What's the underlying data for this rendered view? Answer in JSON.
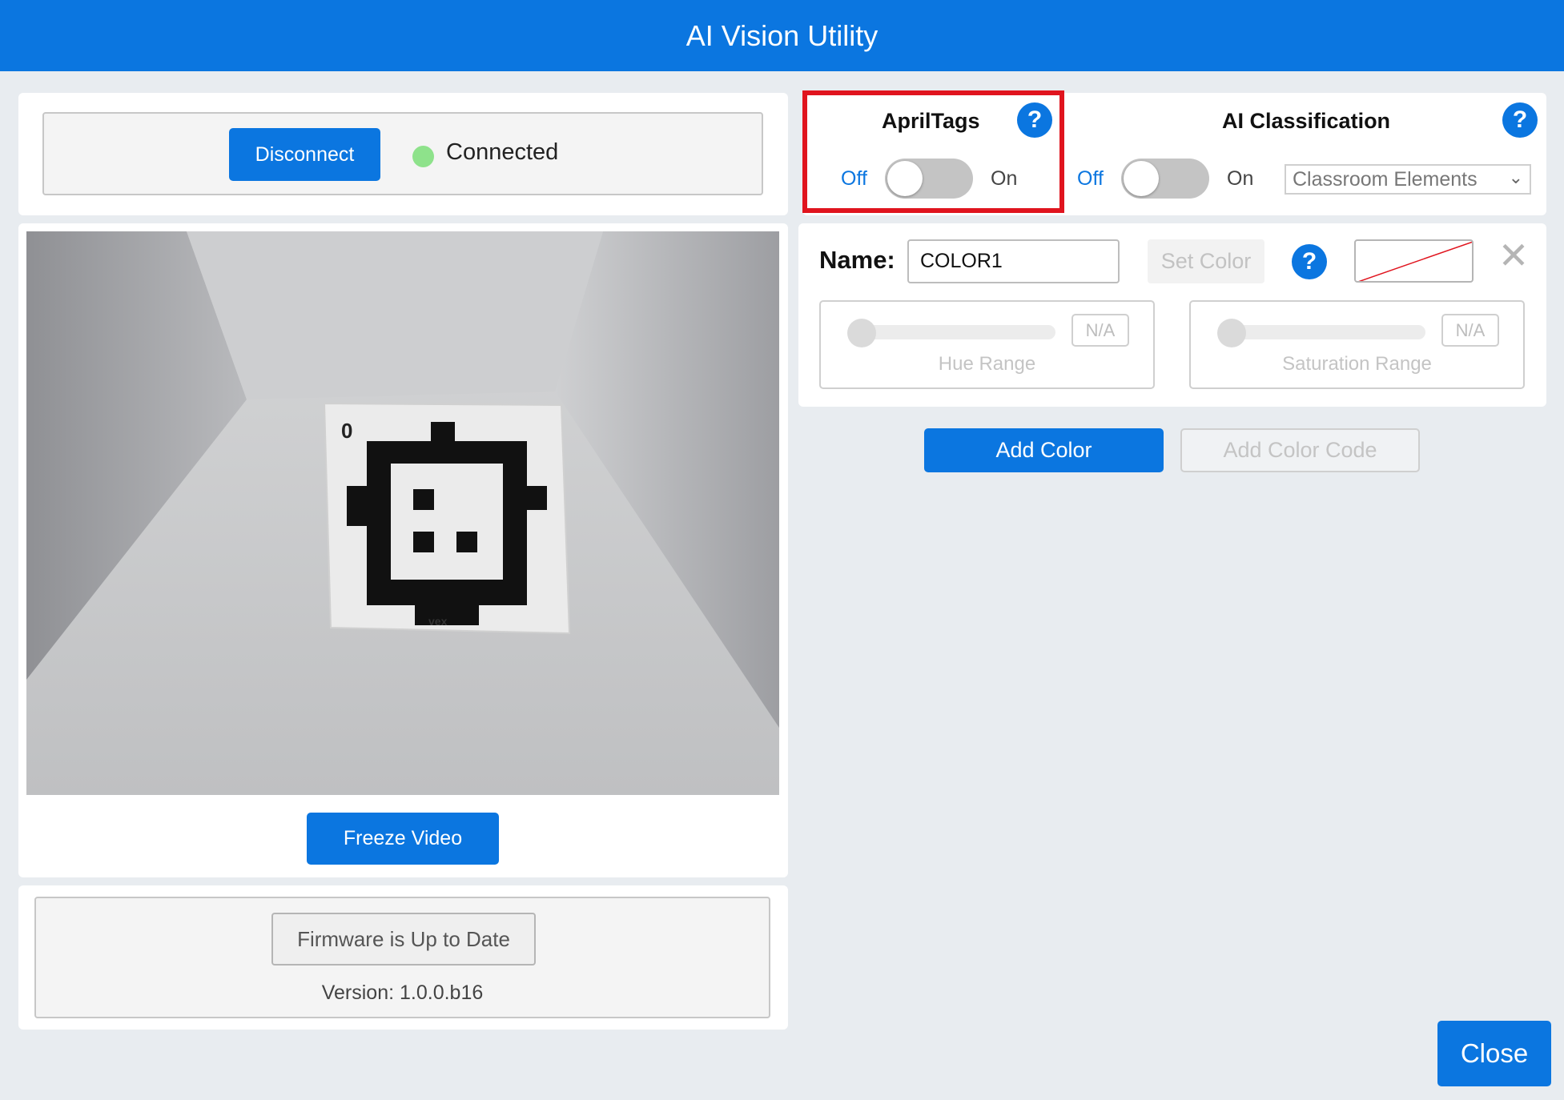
{
  "app": {
    "title": "AI Vision Utility"
  },
  "connection": {
    "button_label": "Disconnect",
    "status": "Connected",
    "status_color": "#8ee28b"
  },
  "video": {
    "freeze_label": "Freeze Video",
    "tag_number": "0",
    "tag_brand": "vex"
  },
  "firmware": {
    "button_label": "Firmware is Up to Date",
    "version_text": "Version: 1.0.0.b16"
  },
  "apriltags": {
    "title": "AprilTags",
    "help": "?",
    "off_label": "Off",
    "on_label": "On",
    "enabled": false
  },
  "classification": {
    "title": "AI Classification",
    "help": "?",
    "off_label": "Off",
    "on_label": "On",
    "enabled": false,
    "selected_model": "Classroom Elements"
  },
  "color": {
    "name_label": "Name:",
    "name_value": "COLOR1",
    "set_color_label": "Set Color",
    "help": "?",
    "close_icon": "✕",
    "hue": {
      "label": "Hue Range",
      "value": "N/A"
    },
    "saturation": {
      "label": "Saturation Range",
      "value": "N/A"
    }
  },
  "actions": {
    "add_color": "Add Color",
    "add_color_code": "Add Color Code",
    "close": "Close"
  },
  "colors": {
    "accent": "#0b76e0",
    "highlight": "#e0141e"
  }
}
